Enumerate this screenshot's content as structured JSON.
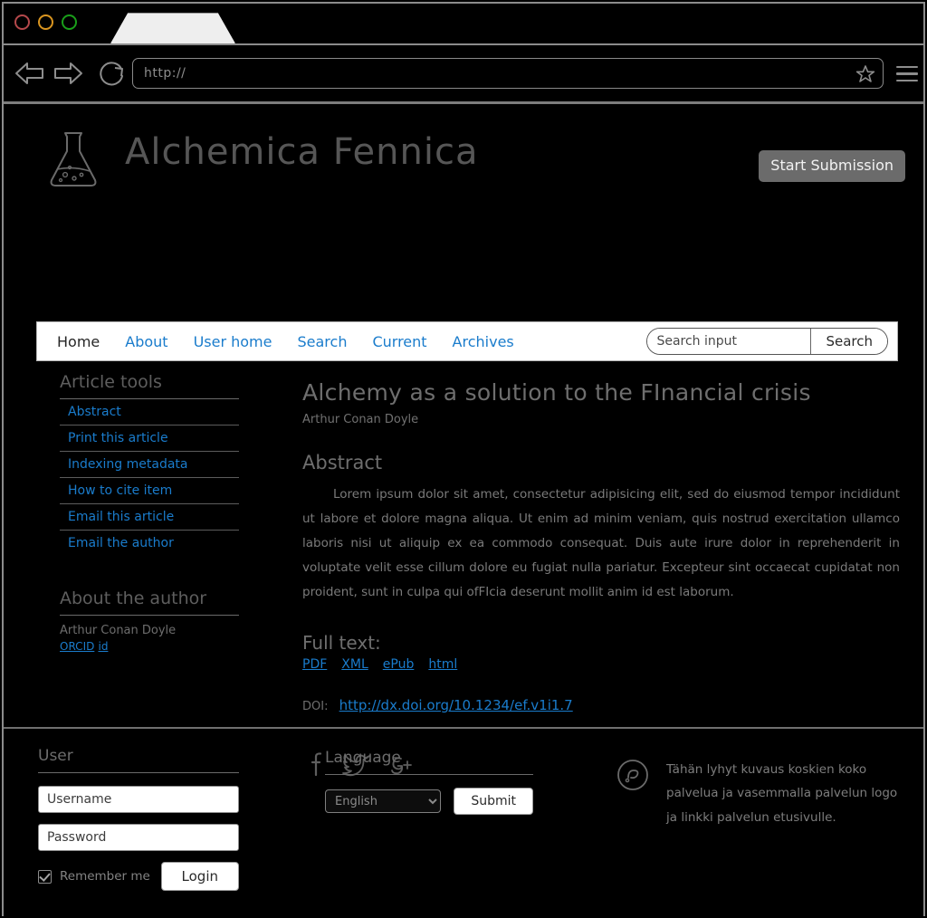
{
  "browser": {
    "url_value": "http://",
    "back_icon": "back-arrow-icon",
    "forward_icon": "forward-arrow-icon",
    "reload_icon": "reload-icon",
    "bookmark_icon": "star-icon",
    "menu_icon": "hamburger-menu-icon",
    "window_dots": [
      "close-dot",
      "minimize-dot",
      "maximize-dot"
    ]
  },
  "masthead": {
    "logo_icon": "erlenmeyer-flask-icon",
    "site_title": "Alchemica Fennica",
    "start_submission_label": "Start Submission"
  },
  "nav": {
    "items": [
      {
        "label": "Home",
        "active": true
      },
      {
        "label": "About",
        "active": false
      },
      {
        "label": "User home",
        "active": false
      },
      {
        "label": "Search",
        "active": false
      },
      {
        "label": "Current",
        "active": false
      },
      {
        "label": "Archives",
        "active": false
      }
    ],
    "search_placeholder": "Search input",
    "search_button_label": "Search"
  },
  "sidebar": {
    "article_tools_heading": "Article tools",
    "tools": [
      "Abstract",
      "Print this article",
      "Indexing metadata",
      "How to cite item",
      "Email this article",
      "Email the author"
    ],
    "about_author_heading": "About the author",
    "author_name": "Arthur Conan Doyle",
    "orcid_label": "ORCID",
    "orcid_suffix": "id"
  },
  "article": {
    "title": "Alchemy as a solution to the FInancial crisis",
    "author": "Arthur Conan Doyle",
    "abstract_heading": "Abstract",
    "abstract_text": "Lorem ipsum dolor sit amet, consectetur adipisicing elit, sed do eiusmod tempor incididunt ut labore et dolore magna aliqua. Ut enim ad minim veniam, quis nostrud exercitation ullamco laboris nisi ut aliquip ex ea commodo consequat. Duis aute irure dolor in reprehenderit in voluptate velit esse cillum dolore eu fugiat nulla pariatur. Excepteur sint occaecat cupidatat non proident, sunt in culpa qui ofFIcia deserunt mollit anim id est laborum.",
    "fulltext_heading": "Full text:",
    "formats": [
      "PDF",
      "XML",
      "ePub",
      "html"
    ],
    "doi_label": "DOI:",
    "doi_url": "http://dx.doi.org/10.1234/ef.v1i1.7",
    "social": [
      "facebook-icon",
      "twitter-icon",
      "google-plus-icon"
    ]
  },
  "footer": {
    "user_heading": "User",
    "username_placeholder": "Username",
    "password_placeholder": "Password",
    "remember_label": "Remember me",
    "login_label": "Login",
    "language_heading": "Language",
    "language_selected": "English",
    "language_options": [
      "English"
    ],
    "submit_label": "Submit",
    "description_icon": "service-logo-icon",
    "description_text": "Tähän lyhyt kuvaus koskien koko palvelua ja vasemmalla palvelun logo ja linkki palvelun etusivulle."
  },
  "colors": {
    "background": "#000000",
    "link": "#1a7ccc",
    "muted_text": "#6e6e6e",
    "button": "#6b6b6b",
    "border": "#8c8c8c"
  }
}
